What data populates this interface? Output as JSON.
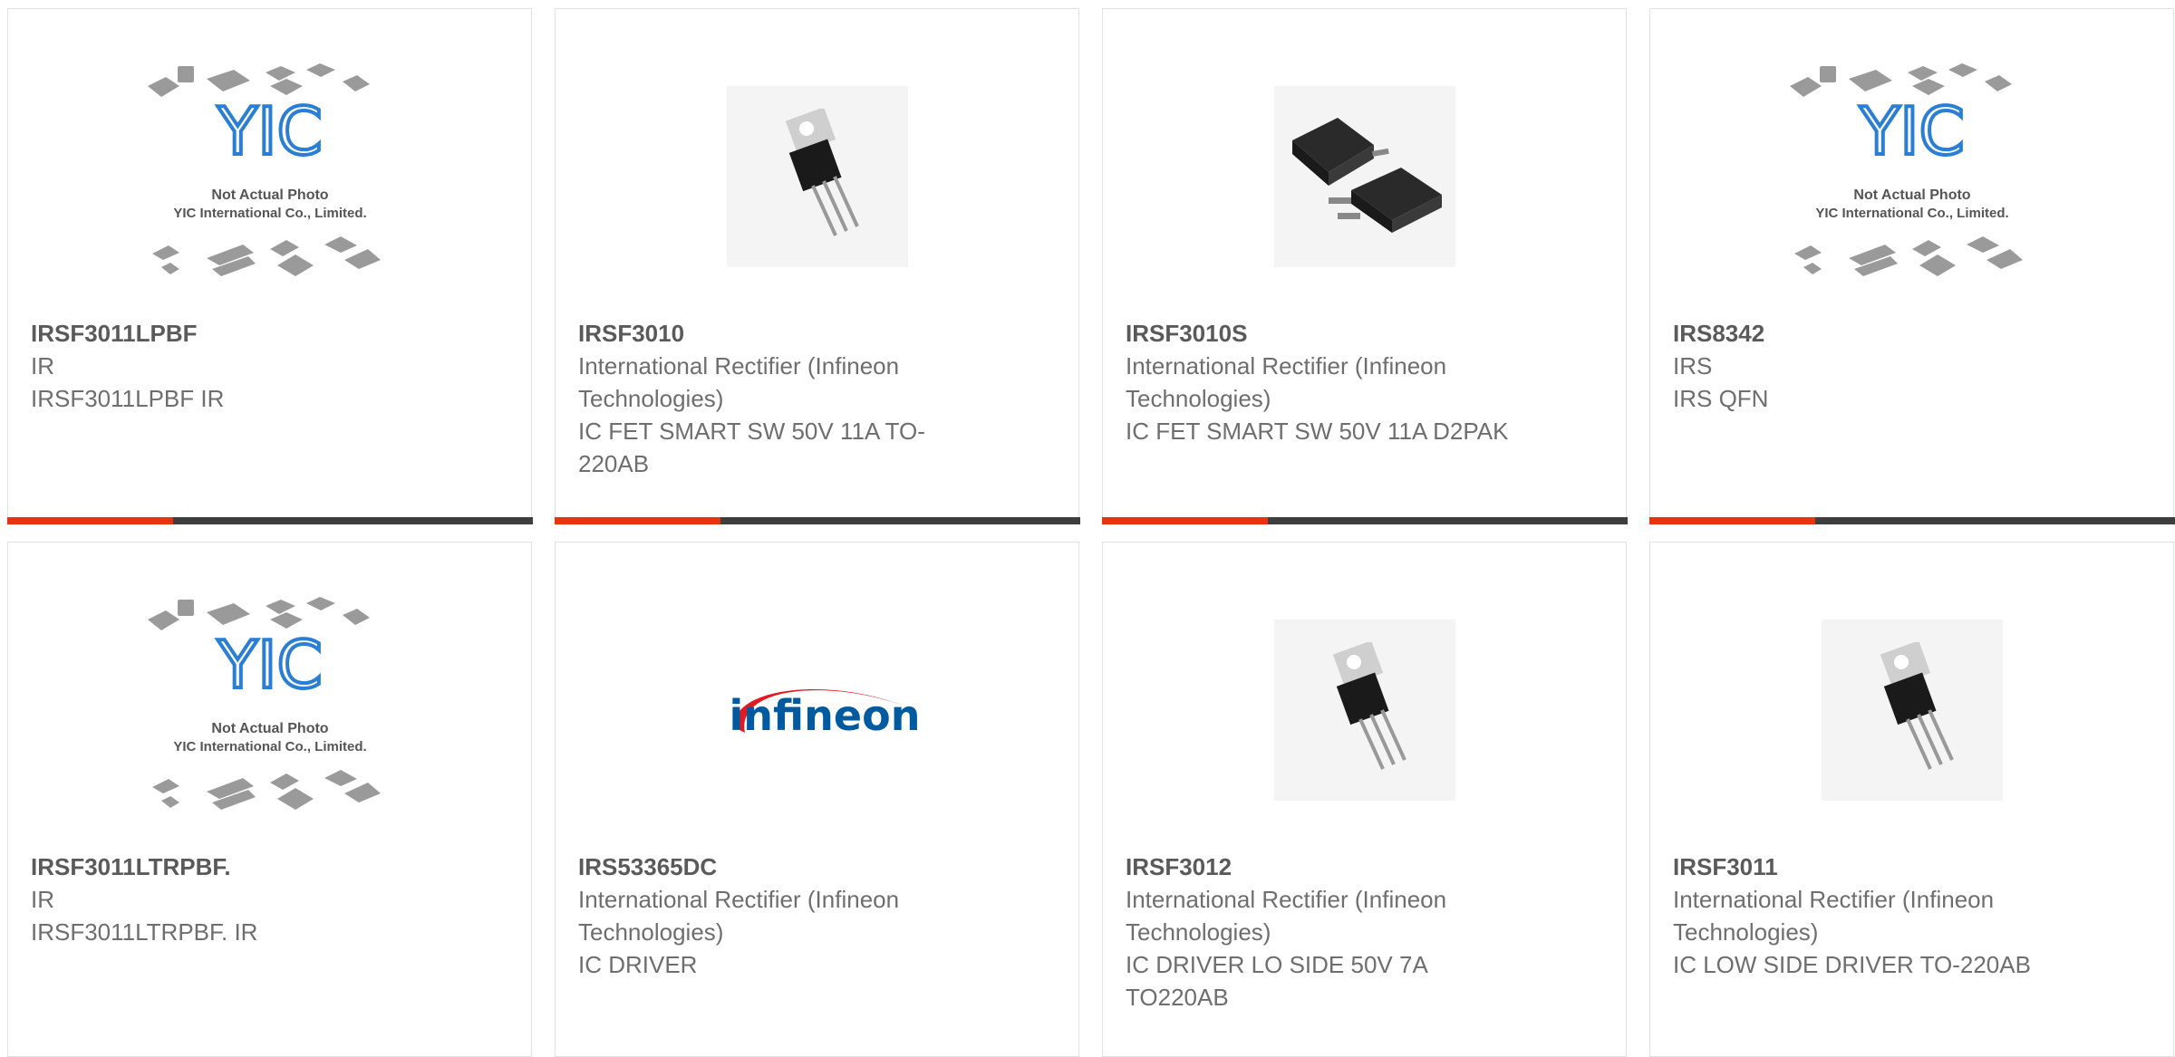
{
  "colors": {
    "accent": "#e8330f",
    "bar": "#3e3e3e",
    "border": "#e2e2e2",
    "yic_blue": "#2a7fd4",
    "infineon_blue": "#005aa0",
    "infineon_red": "#e21b23"
  },
  "placeholder": {
    "line1": "Not Actual Photo",
    "line2": "YIC International Co., Limited.",
    "logo": "YIC"
  },
  "products": [
    {
      "title": "IRSF3011LPBF",
      "manufacturer": "IR",
      "description": "IRSF3011LPBF IR",
      "image": "yic-placeholder"
    },
    {
      "title": "IRSF3010",
      "manufacturer": "International Rectifier (Infineon Technologies)",
      "description": "IC FET SMART SW 50V 11A TO-220AB",
      "image": "to220-photo"
    },
    {
      "title": "IRSF3010S",
      "manufacturer": "International Rectifier (Infineon Technologies)",
      "description": "IC FET SMART SW 50V 11A D2PAK",
      "image": "d2pak-photo"
    },
    {
      "title": "IRS8342",
      "manufacturer": "IRS",
      "description": "IRS QFN",
      "image": "yic-placeholder"
    },
    {
      "title": "IRSF3011LTRPBF.",
      "manufacturer": "IR",
      "description": "IRSF3011LTRPBF. IR",
      "image": "yic-placeholder"
    },
    {
      "title": "IRS53365DC",
      "manufacturer": "International Rectifier (Infineon Technologies)",
      "description": "IC DRIVER",
      "image": "infineon-logo",
      "logo_text": "infineon"
    },
    {
      "title": "IRSF3012",
      "manufacturer": "International Rectifier (Infineon Technologies)",
      "description": "IC DRIVER LO SIDE 50V 7A TO220AB",
      "image": "to220-photo"
    },
    {
      "title": "IRSF3011",
      "manufacturer": "International Rectifier (Infineon Technologies)",
      "description": "IC LOW SIDE DRIVER TO-220AB",
      "image": "to220-photo"
    }
  ]
}
